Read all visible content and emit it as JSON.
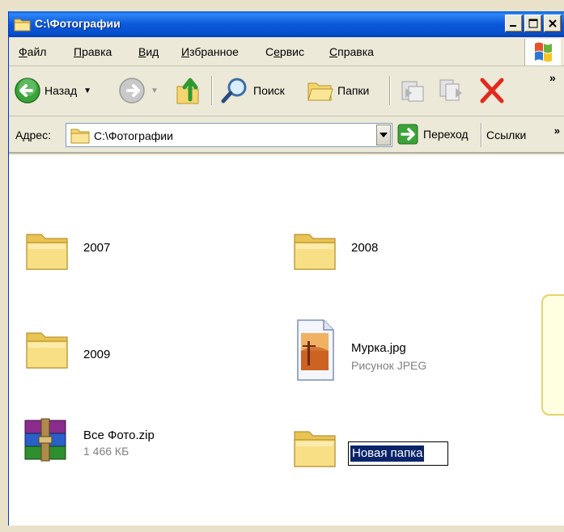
{
  "window": {
    "title": "C:\\Фотографии",
    "accent": "#0a5fd8"
  },
  "menu": {
    "items": [
      {
        "first": "Ф",
        "rest": "айл"
      },
      {
        "first": "П",
        "rest": "равка"
      },
      {
        "first": "В",
        "rest": "ид"
      },
      {
        "first": "И",
        "rest": "збранное"
      },
      {
        "first": "С",
        "rest": "ервис",
        "underline_index": 1
      },
      {
        "first": "С",
        "rest": "правка"
      }
    ],
    "labels": [
      "Файл",
      "Правка",
      "Вид",
      "Избранное",
      "Сервис",
      "Справка"
    ]
  },
  "toolbar": {
    "back_label": "Назад",
    "search_label": "Поиск",
    "folders_label": "Папки",
    "more": "»"
  },
  "address": {
    "label": "Адрес:",
    "value": "C:\\Фотографии",
    "go_label": "Переход",
    "links_label": "Ссылки",
    "links_more": "»"
  },
  "items": [
    {
      "name": "2007",
      "type": "folder"
    },
    {
      "name": "2008",
      "type": "folder"
    },
    {
      "name": "2009",
      "type": "folder"
    },
    {
      "name": "Мурка.jpg",
      "sub": "Рисунок JPEG",
      "type": "jpeg"
    },
    {
      "name": "Все Фото.zip",
      "sub": "1 466 КБ",
      "type": "archive"
    },
    {
      "name": "Новая папка",
      "type": "folder",
      "state": "renaming"
    }
  ],
  "icons": {
    "folder": "folder-icon",
    "jpeg": "jpeg-file-icon",
    "archive": "winrar-archive-icon",
    "back": "back-arrow-icon",
    "forward": "forward-arrow-icon",
    "up": "up-folder-icon",
    "search": "search-magnifier-icon",
    "folders": "folders-icon",
    "move": "move-to-icon",
    "copy": "copy-to-icon",
    "delete": "delete-icon",
    "go": "go-arrow-icon"
  },
  "colors": {
    "selection": "#0a246a",
    "folder_yellow": "#f5d66e",
    "delete_red": "#e3281c",
    "go_green": "#3aa33a"
  }
}
